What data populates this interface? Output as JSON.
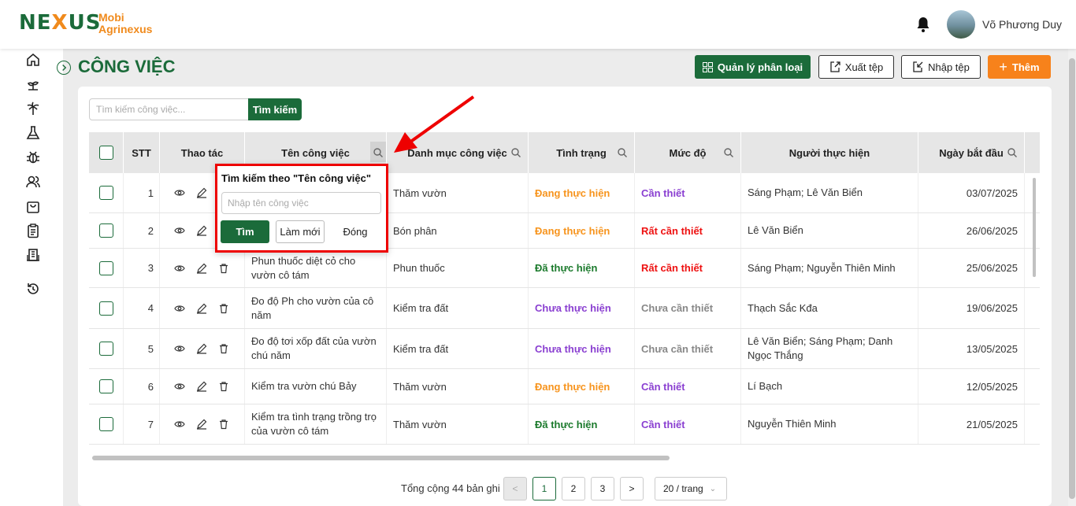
{
  "app": {
    "logo_main": "NEXUS",
    "logo_sub1": "Mobi",
    "logo_sub2": "Agrinexus",
    "username": "Võ Phương Duy"
  },
  "page": {
    "title": "CÔNG VIỆC"
  },
  "toolbar": {
    "manage_label": "Quản lý phân loại",
    "export_label": "Xuất tệp",
    "import_label": "Nhập tệp",
    "add_label": "Thêm"
  },
  "search": {
    "placeholder": "Tìm kiếm công việc...",
    "button": "Tìm kiếm"
  },
  "table": {
    "headers": [
      "STT",
      "Thao tác",
      "Tên công việc",
      "Danh mục công việc",
      "Tình trạng",
      "Mức độ",
      "Người thực hiện",
      "Ngày bắt đầu"
    ],
    "rows": [
      {
        "stt": "1",
        "name": "",
        "category": "Thăm vườn",
        "status": "Đang thực hiện",
        "level": "Cần thiết",
        "people": "Sáng Phạm; Lê  Văn Biển",
        "date": "03/07/2025"
      },
      {
        "stt": "2",
        "name": "",
        "category": "Bón phân",
        "status": "Đang thực hiện",
        "level": "Rất cần thiết",
        "people": "Lê  Văn Biển",
        "date": "26/06/2025"
      },
      {
        "stt": "3",
        "name": "Phun thuốc diệt cỏ cho vườn cô tám",
        "category": "Phun thuốc",
        "status": "Đã thực hiện",
        "level": "Rất cần thiết",
        "people": "Sáng Phạm; Nguyễn  Thiên Minh",
        "date": "25/06/2025"
      },
      {
        "stt": "4",
        "name": "Đo độ Ph cho vườn của cô năm",
        "category": "Kiểm tra đất",
        "status": "Chưa thực hiện",
        "level": "Chưa cần thiết",
        "people": "Thạch Sắc Kđa",
        "date": "19/06/2025"
      },
      {
        "stt": "5",
        "name": "Đo độ tơi xốp đất của vườn chú năm",
        "category": "Kiểm tra đất",
        "status": "Chưa thực hiện",
        "level": "Chưa cần thiết",
        "people": "Lê  Văn Biển; Sáng Phạm; Danh  Ngọc Thắng",
        "date": "13/05/2025"
      },
      {
        "stt": "6",
        "name": "Kiểm tra vườn chú Bảy",
        "category": "Thăm vườn",
        "status": "Đang thực hiện",
        "level": "Cần thiết",
        "people": "Lí  Bạch",
        "date": "12/05/2025"
      },
      {
        "stt": "7",
        "name": "Kiểm tra tình trạng trồng trọ của vườn cô tám",
        "category": "Thăm vườn",
        "status": "Đã thực hiện",
        "level": "Cần thiết",
        "people": "Nguyễn  Thiên Minh",
        "date": "21/05/2025"
      }
    ]
  },
  "popup": {
    "title": "Tìm kiếm theo \"Tên công việc\"",
    "placeholder": "Nhập tên công việc",
    "search_btn": "Tìm",
    "reset_btn": "Làm mới",
    "close_btn": "Đóng"
  },
  "pagination": {
    "total": "Tổng cộng 44 bản ghi",
    "pages": [
      "1",
      "2",
      "3"
    ],
    "page_size": "20 / trang"
  },
  "colors": {
    "brand": "#1b6b3a",
    "accent": "#f7821b",
    "highlight": "#e00000"
  }
}
